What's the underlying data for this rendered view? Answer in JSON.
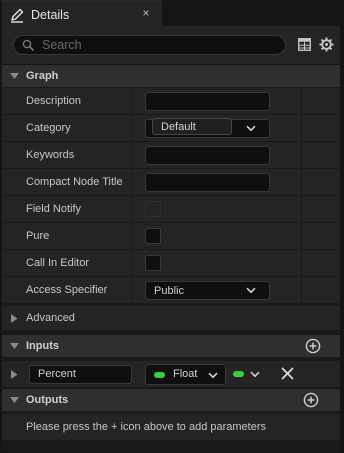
{
  "tab": {
    "title": "Details",
    "icon": "pencil-icon",
    "close_glyph": "×"
  },
  "search": {
    "placeholder": "Search"
  },
  "categories": {
    "graph": "Graph",
    "advanced": "Advanced",
    "inputs": "Inputs",
    "outputs": "Outputs"
  },
  "graph_rows": {
    "description": {
      "label": "Description",
      "value": ""
    },
    "category": {
      "label": "Category",
      "value": "Default"
    },
    "keywords": {
      "label": "Keywords",
      "value": ""
    },
    "compact_node_title": {
      "label": "Compact Node Title",
      "value": ""
    },
    "field_notify": {
      "label": "Field Notify",
      "checked": false
    },
    "pure": {
      "label": "Pure",
      "checked": false
    },
    "call_in_editor": {
      "label": "Call In Editor",
      "checked": false
    },
    "access_specifier": {
      "label": "Access Specifier",
      "value": "Public"
    }
  },
  "input_param": {
    "name": "Percent",
    "type": "Float",
    "pin_color": "#35d13a"
  },
  "outputs_message": "Please press the + icon above to add parameters",
  "colors": {
    "background": "#1a1a1a",
    "row": "#242424",
    "category_header": "#2f2f2f",
    "field": "#0f0f0f",
    "float_pin": "#35d13a"
  }
}
